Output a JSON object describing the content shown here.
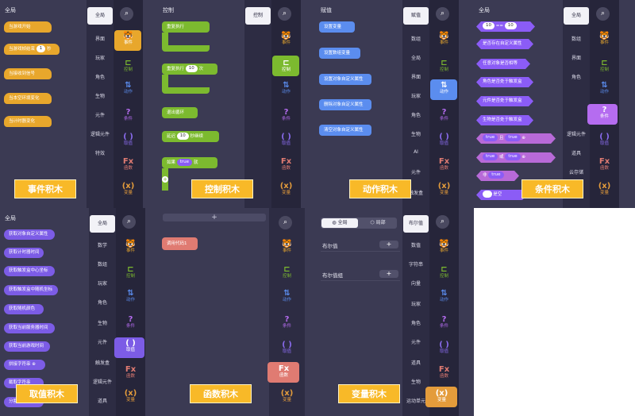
{
  "colors": {
    "panel": "#3b3a53",
    "event": "#e8a72c",
    "control": "#7cba2f",
    "action": "#5b8def",
    "condition": "#8b5cf6",
    "value": "#7c5ce6",
    "function": "#e07b72",
    "caption": "#f8b928"
  },
  "icons": {
    "event": {
      "glyph": "🐯",
      "label": "事件",
      "color": "#e8a72c"
    },
    "control": {
      "glyph": "⊏",
      "label": "控制",
      "color": "#7cba2f"
    },
    "action": {
      "glyph": "⇅",
      "label": "动作",
      "color": "#5b8def"
    },
    "condition": {
      "glyph": "?",
      "label": "条件",
      "color": "#b56cf0"
    },
    "value": {
      "glyph": "( )",
      "label": "取值",
      "color": "#8b6cf0"
    },
    "function": {
      "glyph": "Fx",
      "label": "函数",
      "color": "#e07b72"
    },
    "variable": {
      "glyph": "(x)",
      "label": "变量",
      "color": "#e49c3b"
    }
  },
  "p1": {
    "header": "全局",
    "blocks": [
      "当游戏开始",
      "当游戏帧结束",
      "当接收到信号",
      "当本空环境变化",
      "当计时器变化"
    ],
    "b2_value": "1",
    "b2_suffix": "秒",
    "categories": {
      "selected": "全局",
      "items": [
        "界面",
        "玩家",
        "角色",
        "生物",
        "元件",
        "逻辑元件",
        "特效"
      ]
    },
    "caption": "事件积木"
  },
  "p2": {
    "header": "控制",
    "blocks": [
      "重复执行",
      "重复执行",
      "退出循环",
      "延迟",
      "如果"
    ],
    "b2_value": "10",
    "b2_suffix": "次",
    "b4_value": "10",
    "b4_suffix": "秒继续",
    "b5_value": "true",
    "b5_suffix": "就",
    "categories": {
      "selected": "控制"
    },
    "caption": "控制积木"
  },
  "p3": {
    "header": "赋值",
    "blocks": [
      "设置变量",
      "设置数组变量",
      "设置对象自定义属性",
      "删除对象自定义属性",
      "清空对象自定义属性"
    ],
    "categories": {
      "selected": "赋值",
      "items": [
        "数组",
        "全局",
        "界面",
        "玩家",
        "角色",
        "生物",
        "AI",
        "元件",
        "触发盒"
      ]
    },
    "caption": "动作积木"
  },
  "p4": {
    "header": "全局",
    "row1": {
      "left": "10",
      "op": "==",
      "right": "10"
    },
    "blocks": [
      "是否存在自定义属性",
      "任意对象是否相等",
      "角色是否处于触发盒",
      "元件是否处于触发盒",
      "生物是否处于触发盒"
    ],
    "bool_rows": [
      {
        "left": "true",
        "op": "且",
        "right": "true"
      },
      {
        "left": "true",
        "op": "或",
        "right": "true"
      }
    ],
    "not_block": {
      "label": "非",
      "value": "true"
    },
    "last_block": "是空",
    "categories": {
      "selected": "全局",
      "items": [
        "数组",
        "界面",
        "角色",
        "逻辑元件",
        "道具",
        "云存储"
      ]
    },
    "caption": "条件积木"
  },
  "p5": {
    "header": "全局",
    "blocks": [
      "获取对象自定义属性",
      "获取计时器时间",
      "获取触发盒中心坐标",
      "获取触发盒中随机坐标",
      "获取随机颜色",
      "获取当前服务器时间",
      "获取当前游戏时间",
      "拼接字符串",
      "截取字符串",
      "分割字符串"
    ],
    "categories": {
      "selected": "全局",
      "items": [
        "数学",
        "数组",
        "玩家",
        "角色",
        "生物",
        "元件",
        "触发盒",
        "逻辑元件",
        "道具"
      ]
    },
    "caption": "取值积木"
  },
  "p6": {
    "add_symbol": "+",
    "blocks": [
      "调用代码1"
    ],
    "caption": "函数积木"
  },
  "p7": {
    "scope_tabs": [
      "全局",
      "局部"
    ],
    "rows": [
      "布尔值",
      "布尔值组"
    ],
    "add_symbol": "+",
    "categories": {
      "selected": "布尔值",
      "items": [
        "数值",
        "字符串",
        "向量",
        "玩家",
        "角色",
        "元件",
        "道具",
        "生物",
        "运动单元"
      ]
    },
    "caption": "变量积木"
  }
}
